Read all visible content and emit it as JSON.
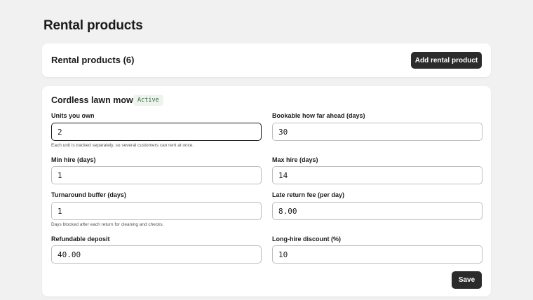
{
  "page": {
    "title": "Rental products"
  },
  "header_card": {
    "heading": "Rental products (6)",
    "add_label": "Add rental product"
  },
  "product": {
    "name": "Cordless lawn mower",
    "status": "Active",
    "fields": {
      "units": {
        "label": "Units you own",
        "value": "2",
        "help": "Each unit is tracked separately, so several customers can rent at once."
      },
      "bookable": {
        "label": "Bookable how far ahead (days)",
        "value": "30"
      },
      "min_hire": {
        "label": "Min hire (days)",
        "value": "1"
      },
      "max_hire": {
        "label": "Max hire (days)",
        "value": "14"
      },
      "turnaround": {
        "label": "Turnaround buffer (days)",
        "value": "1",
        "help": "Days blocked after each return for cleaning and checks."
      },
      "late_fee": {
        "label": "Late return fee (per day)",
        "value": "8.00"
      },
      "deposit": {
        "label": "Refundable deposit",
        "value": "40.00"
      },
      "discount": {
        "label": "Long-hire discount (%)",
        "value": "10"
      }
    },
    "save_label": "Save"
  }
}
